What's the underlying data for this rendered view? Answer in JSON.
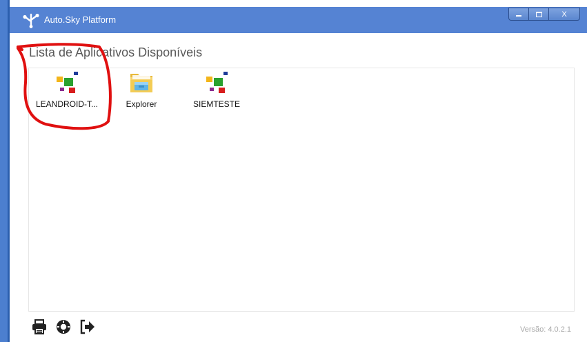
{
  "window": {
    "title": "Auto.Sky Platform",
    "title_icon": "auto-sky-logo-icon",
    "controls": [
      "minimize-icon",
      "maximize-icon",
      "close-icon"
    ],
    "close_label": "X",
    "accent_color": "#5583d3"
  },
  "main": {
    "heading": "Lista de Aplicativos Disponíveis",
    "apps": [
      {
        "label": "LEANDROID-T...",
        "icon": "colored-tiles-app-icon"
      },
      {
        "label": "Explorer",
        "icon": "file-explorer-folder-icon"
      },
      {
        "label": "SIEMTESTE",
        "icon": "colored-tiles-app-icon"
      }
    ],
    "annotation_color": "#e01010"
  },
  "footer": {
    "icons": [
      "printer-icon",
      "gear-icon",
      "sign-out-icon"
    ],
    "version": "Versão: 4.0.2.1"
  }
}
